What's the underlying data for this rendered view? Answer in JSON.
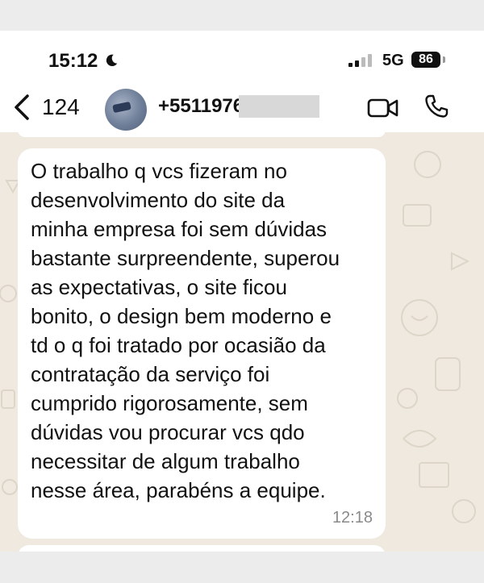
{
  "status_bar": {
    "time": "15:12",
    "moon_icon": "moon-icon",
    "signal_icon": "cellular-signal-icon",
    "network": "5G",
    "battery": "86"
  },
  "header": {
    "back_icon": "chevron-left-icon",
    "back_count": "124",
    "contact": "+5511976",
    "video_icon": "video-camera-icon",
    "call_icon": "phone-icon"
  },
  "message": {
    "text": "O trabalho q vcs fizeram no\ndesenvolvimento do site da\nminha empresa foi sem dúvidas\nbastante surpreendente, superou\nas expectativas, o site ficou\nbonito, o design bem moderno e\ntd o q foi tratado por ocasião da\ncontratação da serviço foi\ncumprido rigorosamente, sem\ndúvidas vou procurar vcs qdo\nnecessitar de algum trabalho\nnesse área, parabéns a equipe.",
    "time": "12:18"
  },
  "colors": {
    "chat_background": "#efe9df",
    "bubble": "#ffffff",
    "doodle": "#ddd5c8"
  }
}
